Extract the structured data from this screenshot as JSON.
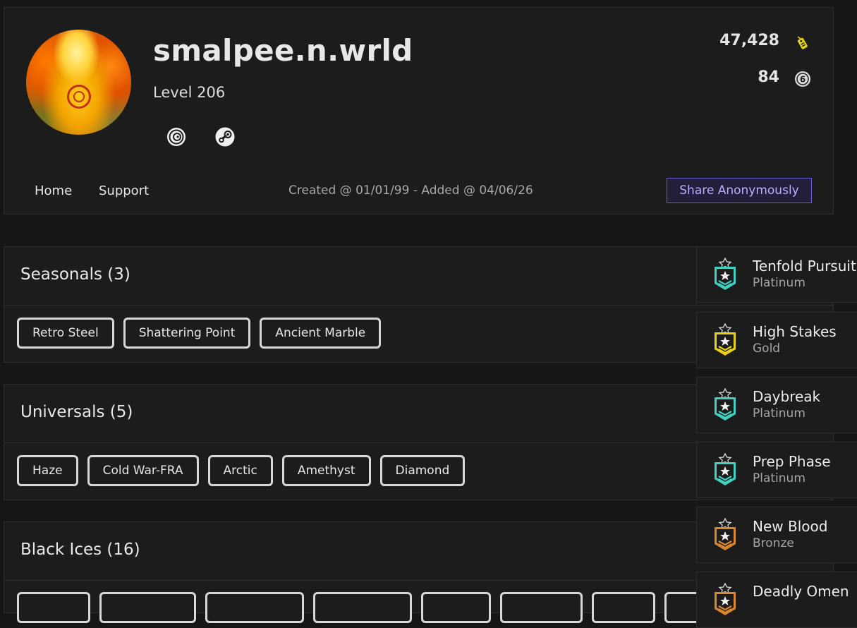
{
  "profile": {
    "username": "smalpee.n.wrld",
    "level": "Level 206",
    "platforms": [
      "ubisoft-icon",
      "steam-icon"
    ],
    "stats": [
      {
        "value": "47,428",
        "icon": "renown-tag-icon"
      },
      {
        "value": "84",
        "icon": "r6-credits-icon"
      }
    ]
  },
  "nav": {
    "home": "Home",
    "support": "Support",
    "created": "Created @ 01/01/99 - Added @ 04/06/26",
    "share": "Share Anonymously"
  },
  "sections": [
    {
      "title": "Seasonals (3)",
      "chips": [
        "Retro Steel",
        "Shattering Point",
        "Ancient Marble"
      ]
    },
    {
      "title": "Universals (5)",
      "chips": [
        "Haze",
        "Cold War-FRA",
        "Arctic",
        "Amethyst",
        "Diamond"
      ]
    },
    {
      "title": "Black Ices (16)",
      "chips": []
    }
  ],
  "challenges": [
    {
      "name": "Tenfold Pursuit",
      "tier": "Platinum",
      "color": "#3fd0c0"
    },
    {
      "name": "High Stakes",
      "tier": "Gold",
      "color": "#e6d21a"
    },
    {
      "name": "Daybreak",
      "tier": "Platinum",
      "color": "#3fd0c0"
    },
    {
      "name": "Prep Phase",
      "tier": "Platinum",
      "color": "#3fd0c0"
    },
    {
      "name": "New Blood",
      "tier": "Bronze",
      "color": "#d9872e"
    },
    {
      "name": "Deadly Omen",
      "tier": "",
      "color": "#d9872e"
    }
  ],
  "colors": {
    "accent": "#6a5cd6",
    "background": "#161616",
    "panel": "#1c1c1c"
  }
}
